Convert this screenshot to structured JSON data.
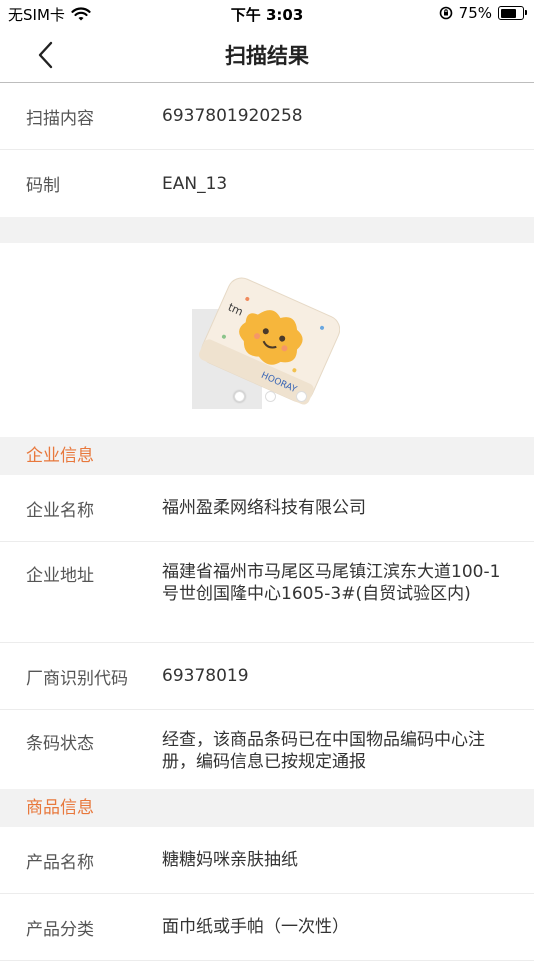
{
  "status_bar": {
    "carrier": "无SIM卡",
    "time": "下午 3:03",
    "battery_percent": "75%",
    "battery_level": 0.75
  },
  "nav": {
    "title": "扫描结果",
    "back_icon": "chevron-left-icon"
  },
  "scan": {
    "content_label": "扫描内容",
    "content_value": "6937801920258",
    "type_label": "码制",
    "type_value": "EAN_13"
  },
  "carousel": {
    "page_count": 3,
    "active_index": 0,
    "image_text_1": "tm",
    "image_text_2": "HOORAY"
  },
  "company": {
    "section_title": "企业信息",
    "rows": [
      {
        "label": "企业名称",
        "value": "福州盈柔网络科技有限公司"
      },
      {
        "label": "企业地址",
        "value": "福建省福州市马尾区马尾镇江滨东大道100-1号世创国隆中心1605-3#(自贸试验区内)"
      },
      {
        "label": "厂商识别代码",
        "value": "69378019"
      },
      {
        "label": "条码状态",
        "value": "经查，该商品条码已在中国物品编码中心注册，编码信息已按规定通报"
      }
    ]
  },
  "product": {
    "section_title": "商品信息",
    "rows": [
      {
        "label": "产品名称",
        "value": "糖糖妈咪亲肤抽纸"
      },
      {
        "label": "产品分类",
        "value": "面巾纸或手帕（一次性）"
      }
    ]
  },
  "colors": {
    "accent": "#e8783c",
    "section_bg": "#f2f2f2",
    "divider": "#ececec"
  }
}
